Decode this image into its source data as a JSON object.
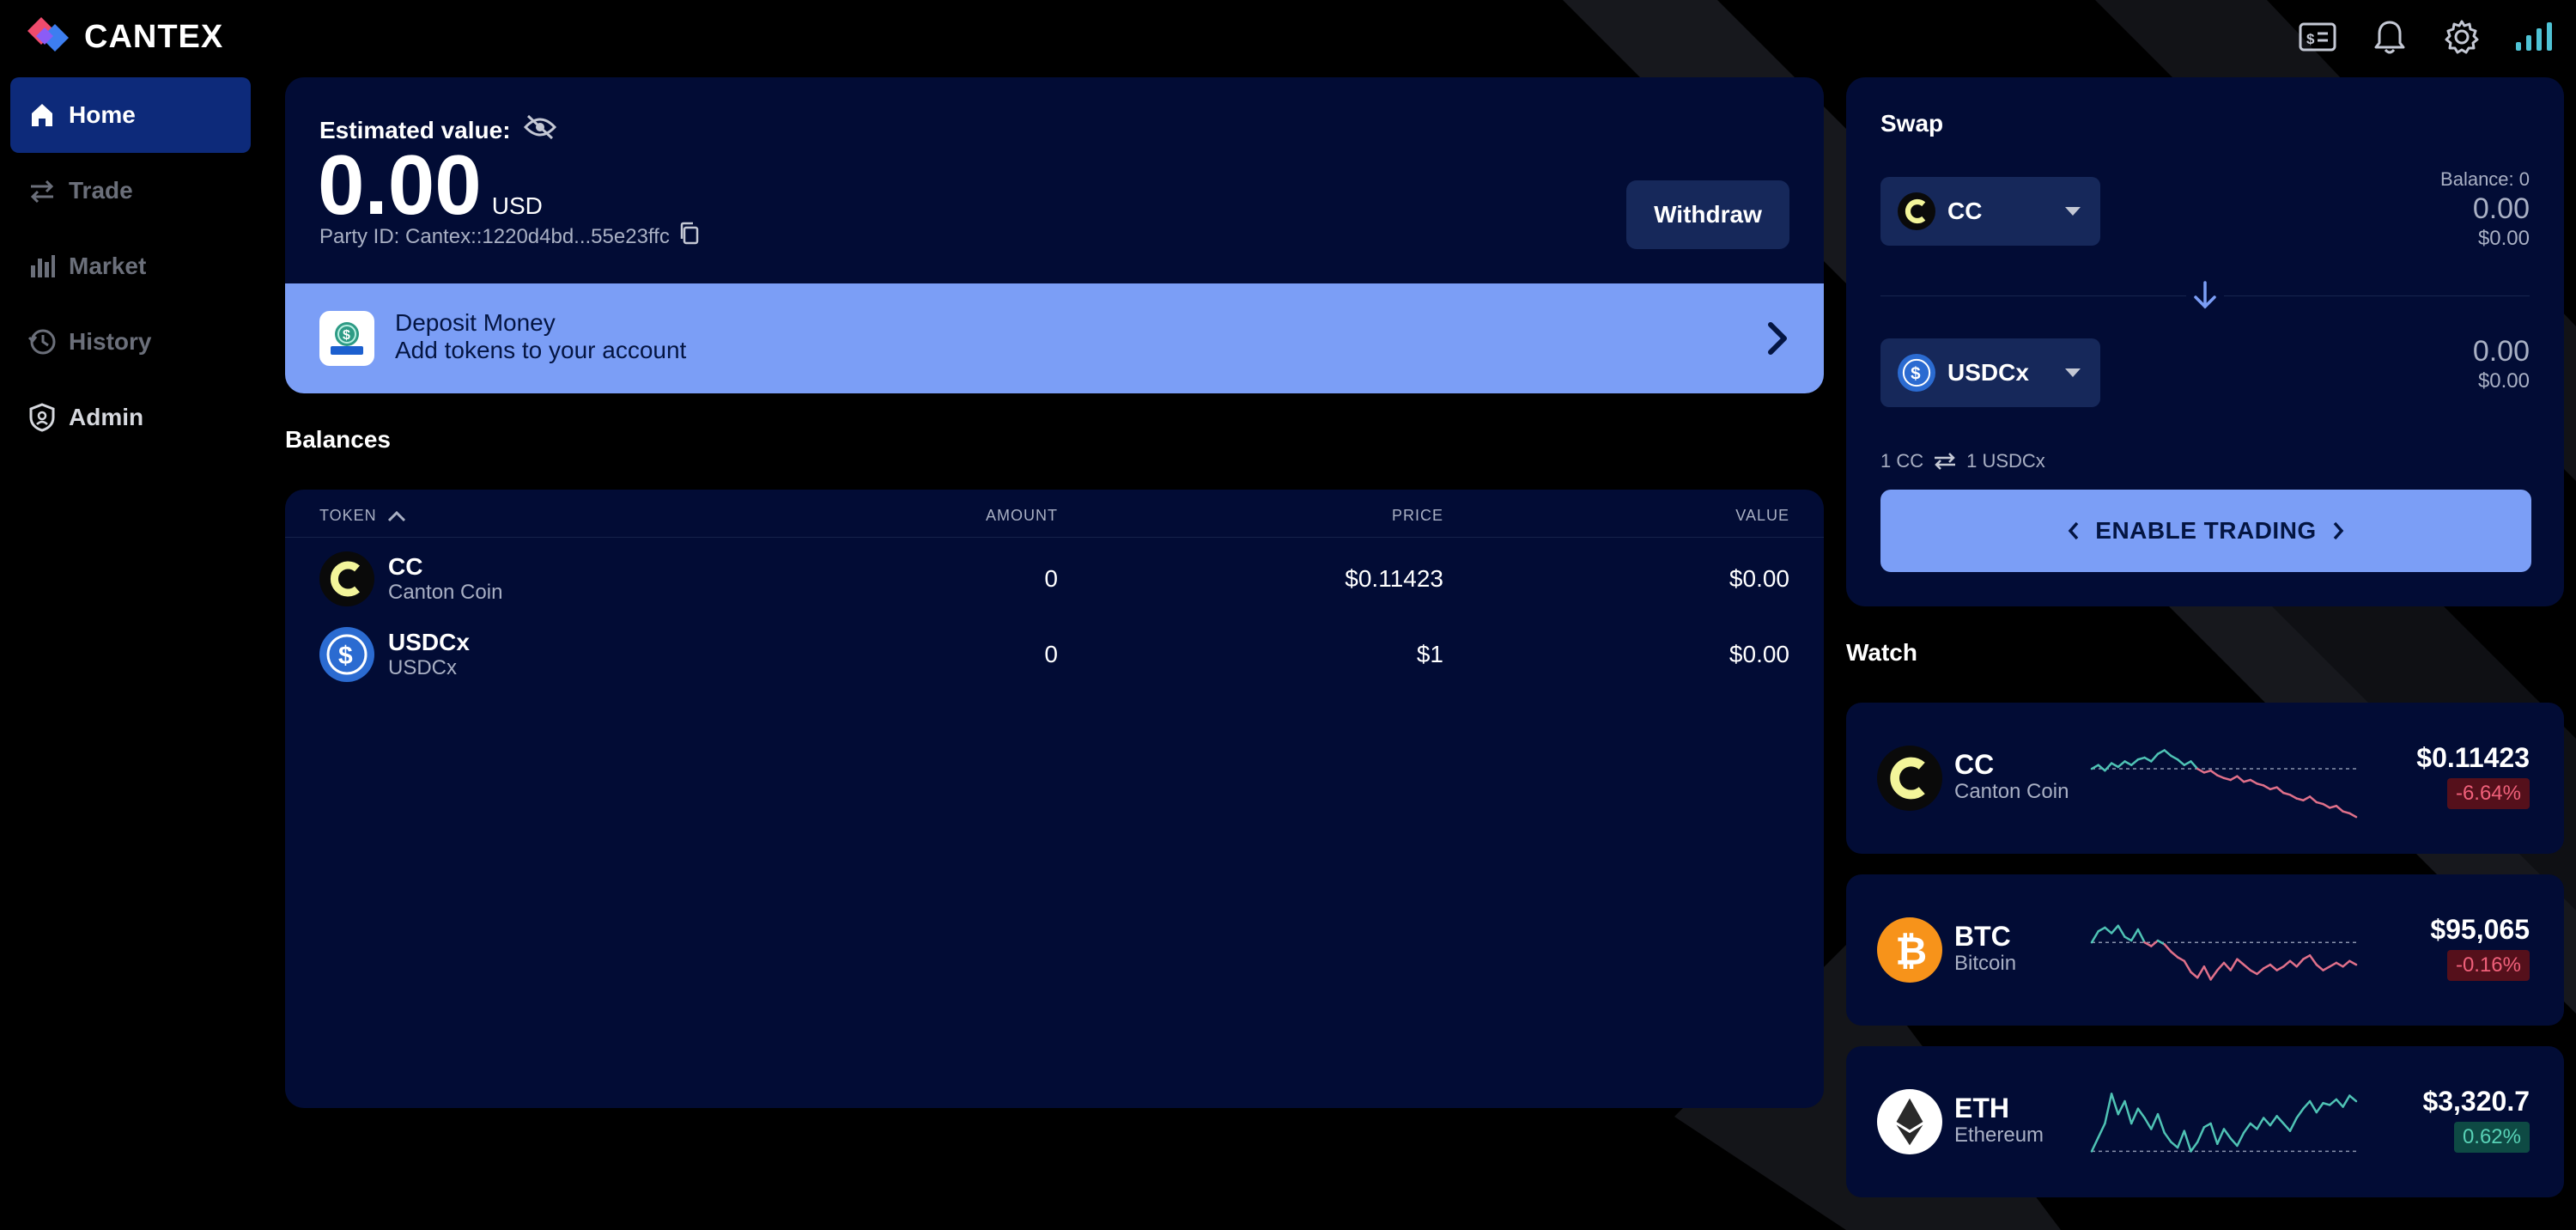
{
  "app": {
    "name": "CANTEX"
  },
  "colors": {
    "accent": "#7b9ef6",
    "panel": "#020c35",
    "nav_active": "#0d2a7a",
    "negative": "#f0607a",
    "positive": "#58d2b6",
    "spark_up": "#4fc3b5",
    "spark_down": "#e0708a"
  },
  "topbar": {
    "icons": [
      "wallet-icon",
      "bell-icon",
      "gear-icon",
      "signal-icon"
    ]
  },
  "sidebar": {
    "items": [
      {
        "label": "Home",
        "icon": "home-icon",
        "active": true
      },
      {
        "label": "Trade",
        "icon": "arrows-icon"
      },
      {
        "label": "Market",
        "icon": "bar-chart-icon"
      },
      {
        "label": "History",
        "icon": "history-icon"
      },
      {
        "label": "Admin",
        "icon": "shield-icon"
      }
    ]
  },
  "estimate": {
    "label": "Estimated value:",
    "value": "0.00",
    "unit": "USD",
    "party_id": "Party ID: Cantex::1220d4bd...55e23ffc",
    "withdraw_label": "Withdraw"
  },
  "deposit": {
    "title": "Deposit Money",
    "subtitle": "Add tokens to your account"
  },
  "balances": {
    "title": "Balances",
    "columns": {
      "token": "TOKEN",
      "amount": "AMOUNT",
      "price": "PRICE",
      "value": "VALUE"
    },
    "rows": [
      {
        "symbol": "CC",
        "name": "Canton Coin",
        "amount": "0",
        "price": "$0.11423",
        "value": "$0.00"
      },
      {
        "symbol": "USDCx",
        "name": "USDCx",
        "amount": "0",
        "price": "$1",
        "value": "$0.00"
      }
    ]
  },
  "swap": {
    "title": "Swap",
    "from": {
      "symbol": "CC",
      "balance": "Balance: 0",
      "amount": "0.00",
      "usd": "$0.00"
    },
    "to": {
      "symbol": "USDCx",
      "amount": "0.00",
      "usd": "$0.00"
    },
    "rate_from": "1 CC",
    "rate_to": "1 USDCx",
    "enable_label": "ENABLE TRADING"
  },
  "watch": {
    "title": "Watch",
    "items": [
      {
        "symbol": "CC",
        "name": "Canton Coin",
        "price": "$0.11423",
        "change": "-6.64%",
        "direction": "down",
        "spark": [
          0.62,
          0.66,
          0.6,
          0.68,
          0.64,
          0.7,
          0.66,
          0.72,
          0.74,
          0.7,
          0.78,
          0.82,
          0.76,
          0.72,
          0.66,
          0.7,
          0.62,
          0.58,
          0.6,
          0.55,
          0.52,
          0.5,
          0.54,
          0.48,
          0.5,
          0.46,
          0.44,
          0.4,
          0.42,
          0.36,
          0.34,
          0.3,
          0.28,
          0.32,
          0.26,
          0.24,
          0.2,
          0.22,
          0.16,
          0.14,
          0.1
        ]
      },
      {
        "symbol": "BTC",
        "name": "Bitcoin",
        "price": "$95,065",
        "change": "-0.16%",
        "direction": "down",
        "spark": [
          0.6,
          0.72,
          0.76,
          0.7,
          0.78,
          0.66,
          0.62,
          0.74,
          0.6,
          0.56,
          0.62,
          0.58,
          0.5,
          0.44,
          0.4,
          0.28,
          0.22,
          0.34,
          0.2,
          0.3,
          0.38,
          0.3,
          0.42,
          0.36,
          0.3,
          0.26,
          0.32,
          0.36,
          0.3,
          0.34,
          0.4,
          0.34,
          0.42,
          0.46,
          0.36,
          0.3,
          0.34,
          0.38,
          0.34,
          0.4,
          0.36
        ]
      },
      {
        "symbol": "ETH",
        "name": "Ethereum",
        "price": "$3,320.7",
        "change": "0.62%",
        "direction": "up",
        "spark": [
          0.2,
          0.35,
          0.5,
          0.82,
          0.6,
          0.74,
          0.5,
          0.66,
          0.56,
          0.44,
          0.6,
          0.4,
          0.3,
          0.24,
          0.42,
          0.2,
          0.3,
          0.46,
          0.5,
          0.28,
          0.44,
          0.34,
          0.26,
          0.4,
          0.5,
          0.44,
          0.56,
          0.48,
          0.58,
          0.5,
          0.42,
          0.56,
          0.66,
          0.74,
          0.62,
          0.72,
          0.7,
          0.76,
          0.68,
          0.8,
          0.74
        ]
      }
    ]
  }
}
